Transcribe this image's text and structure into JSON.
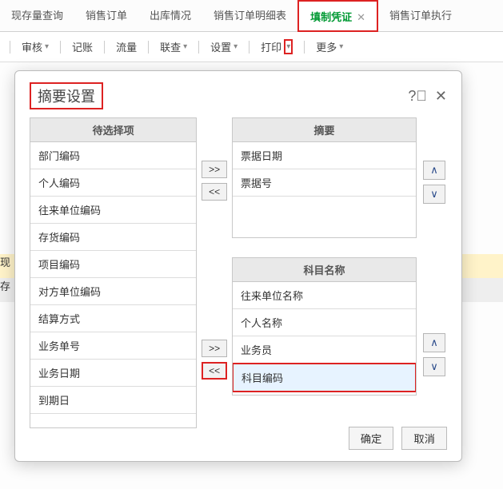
{
  "tabs": {
    "items": [
      {
        "label": "现存量查询"
      },
      {
        "label": "销售订单"
      },
      {
        "label": "出库情况"
      },
      {
        "label": "销售订单明细表"
      },
      {
        "label": "填制凭证",
        "active": true
      },
      {
        "label": "销售订单执行"
      }
    ]
  },
  "toolbar": {
    "items": [
      {
        "label": "审核",
        "caret": true
      },
      {
        "label": "记账"
      },
      {
        "label": "流量"
      },
      {
        "label": "联查",
        "caret": true
      },
      {
        "label": "设置",
        "caret": true
      },
      {
        "label": "打印",
        "caret": true,
        "hl": true
      },
      {
        "label": "更多",
        "caret": true
      }
    ]
  },
  "bg_rows": {
    "r1": "现",
    "r2": "存"
  },
  "dialog": {
    "title": "摘要设置",
    "candidates_header": "待选择项",
    "candidates": [
      "部门编码",
      "个人编码",
      "往来单位编码",
      "存货编码",
      "项目编码",
      "对方单位编码",
      "结算方式",
      "业务单号",
      "业务日期",
      "到期日"
    ],
    "summary_header": "摘要",
    "summary_items": [
      "票据日期",
      "票据号"
    ],
    "subject_header": "科目名称",
    "subject_items": [
      "往来单位名称",
      "个人名称",
      "业务员",
      "科目编码"
    ],
    "ok": "确定",
    "cancel": "取消"
  }
}
